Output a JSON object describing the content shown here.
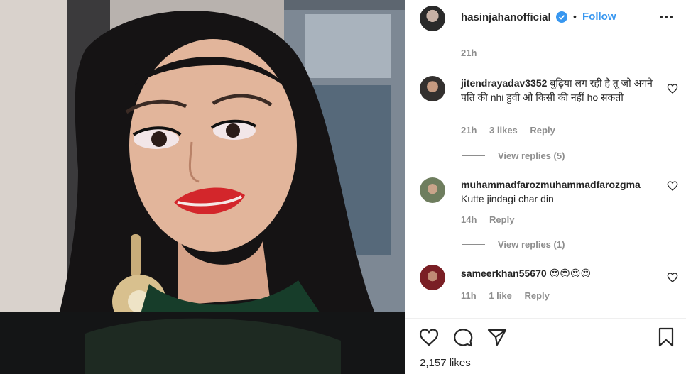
{
  "post": {
    "username": "hasinjahanofficial",
    "follow_label": "Follow",
    "dot": "•",
    "caption_time": "21h",
    "likes": "2,157 likes"
  },
  "comments": [
    {
      "author": "jitendrayadav3352",
      "text": "बुढ़िया लग रही है तू जो अगने पति की nhi हुवी ओ किसी की नहीं ho सकती",
      "time": "21h",
      "likes": "3 likes",
      "reply": "Reply",
      "view_replies": "View replies (5)"
    },
    {
      "author": "muhammadfarozmuhammadfarozgma",
      "text": "Kutte jindagi char din",
      "time": "14h",
      "likes": "",
      "reply": "Reply",
      "view_replies": "View replies (1)"
    },
    {
      "author": "sameerkhan55670",
      "text": "😍😍😍😍",
      "time": "11h",
      "likes": "1 like",
      "reply": "Reply",
      "view_replies": ""
    }
  ],
  "icons": {
    "verified": "verified-badge-icon",
    "more": "more-options-icon",
    "like": "heart-icon",
    "comment": "comment-icon",
    "share": "paper-plane-icon",
    "save": "bookmark-icon"
  },
  "colors": {
    "accent": "#3897f0",
    "muted": "#8e8e8e",
    "text": "#262626",
    "border": "#efefef"
  }
}
